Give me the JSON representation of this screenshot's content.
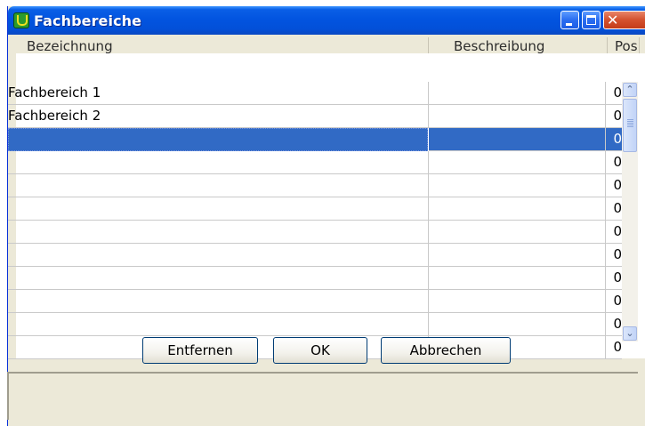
{
  "window": {
    "title": "Fachbereiche",
    "controls": {
      "minimize_icon": "minimize-icon",
      "maximize_icon": "maximize-icon",
      "close_icon": "close-icon"
    },
    "close_glyph": "✕"
  },
  "table": {
    "columns": [
      "Bezeichnung",
      "Beschreibung",
      "Pos"
    ],
    "rows": [
      {
        "bezeichnung": "Fachbereich 1",
        "beschreibung": "",
        "pos": "0"
      },
      {
        "bezeichnung": "Fachbereich 2",
        "beschreibung": "",
        "pos": "0"
      },
      {
        "bezeichnung": "",
        "beschreibung": "",
        "pos": "0"
      },
      {
        "bezeichnung": "",
        "beschreibung": "",
        "pos": "0"
      },
      {
        "bezeichnung": "",
        "beschreibung": "",
        "pos": "0"
      },
      {
        "bezeichnung": "",
        "beschreibung": "",
        "pos": "0"
      },
      {
        "bezeichnung": "",
        "beschreibung": "",
        "pos": "0"
      },
      {
        "bezeichnung": "",
        "beschreibung": "",
        "pos": "0"
      },
      {
        "bezeichnung": "",
        "beschreibung": "",
        "pos": "0"
      },
      {
        "bezeichnung": "",
        "beschreibung": "",
        "pos": "0"
      },
      {
        "bezeichnung": "",
        "beschreibung": "",
        "pos": "0"
      },
      {
        "bezeichnung": "",
        "beschreibung": "",
        "pos": "0"
      }
    ],
    "selected_row": 2
  },
  "scrollbar": {
    "up_glyph": "⌃",
    "down_glyph": "⌄"
  },
  "buttons": {
    "remove": "Entfernen",
    "ok": "OK",
    "cancel": "Abbrechen"
  },
  "colors": {
    "titlebar": "#0254e0",
    "selection": "#316ac5",
    "window_bg": "#ece9d8"
  }
}
